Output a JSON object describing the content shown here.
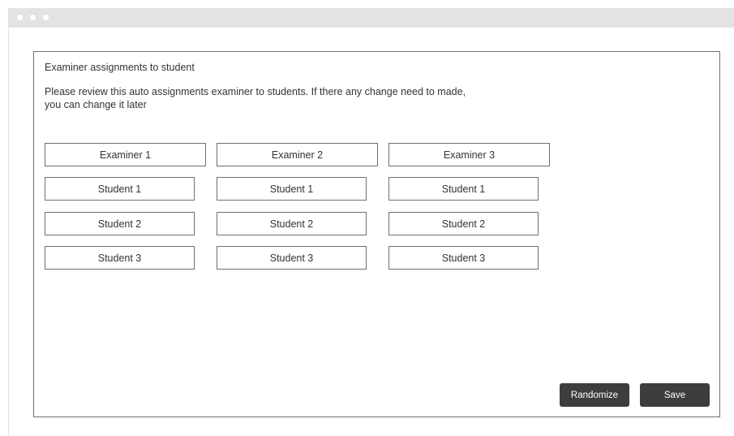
{
  "panel": {
    "title": "Examiner assignments to student",
    "description": "Please review this auto assignments examiner to students. If there any change need to made, you can change it later"
  },
  "examiners": [
    {
      "name": "Examiner 1",
      "students": [
        "Student 1",
        "Student 2",
        "Student 3"
      ]
    },
    {
      "name": "Examiner 2",
      "students": [
        "Student 1",
        "Student 2",
        "Student 3"
      ]
    },
    {
      "name": "Examiner 3",
      "students": [
        "Student 1",
        "Student 2",
        "Student 3"
      ]
    }
  ],
  "actions": {
    "randomize_label": "Randomize",
    "save_label": "Save"
  },
  "colors": {
    "button_bg": "#3d3d3d",
    "border": "#707070",
    "titlebar": "#e3e3e3"
  }
}
